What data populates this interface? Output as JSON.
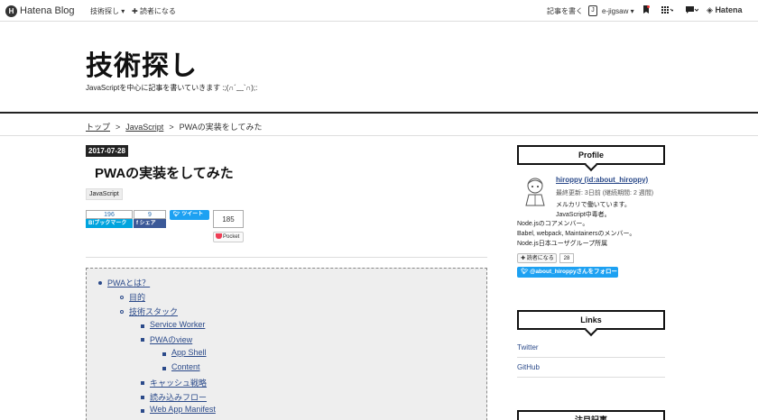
{
  "header": {
    "logo_text": "Hatena Blog",
    "nav_search": "技術探し ▾",
    "nav_follow": "読者になる",
    "write_label": "記事を書く",
    "user_name": "e-jigsaw ▾",
    "hatena_label": "Hatena"
  },
  "blog": {
    "title": "技術探し",
    "description": "JavaScriptを中心に記事を書いていきます :;(∩´﹏`∩);:"
  },
  "breadcrumb": {
    "top": "トップ",
    "category": "JavaScript",
    "current": "PWAの実装をしてみた"
  },
  "entry": {
    "date": "2017-07-28",
    "title": "PWAの実装をしてみた",
    "category": "JavaScript"
  },
  "share": {
    "hatena_count": "196",
    "hatena_label": "B!ブックマーク",
    "facebook_count": "9",
    "facebook_label": "f シェア",
    "tweet_label": "ツイート",
    "pocket_count": "185",
    "pocket_label": "Pocket"
  },
  "toc": [
    "PWAとは？",
    "目的",
    "技術スタック",
    "Service Worker",
    "PWAのview",
    "App Shell",
    "Content",
    "キャッシュ戦略",
    "読み込みフロー",
    "Web App Manifest"
  ],
  "profile": {
    "heading": "Profile",
    "name": "hiroppy (id:about_hiroppy)",
    "meta": "最終更新: 3日前 (継続期間: 2 週間)",
    "lines": [
      "メルカリで働いています。",
      "JavaScript中毒者。",
      "Node.jsのコアメンバー。",
      "Babel, webpack, Maintainersのメンバー。",
      "Node.js日本ユーザグループ所属"
    ],
    "follow_label": "読者になる",
    "follow_count": "28",
    "twitter_follow": "@about_hiroppyさんをフォロー"
  },
  "links": {
    "heading": "Links",
    "items": [
      "Twitter",
      "GitHub"
    ]
  },
  "featured": {
    "heading": "注目記事"
  }
}
